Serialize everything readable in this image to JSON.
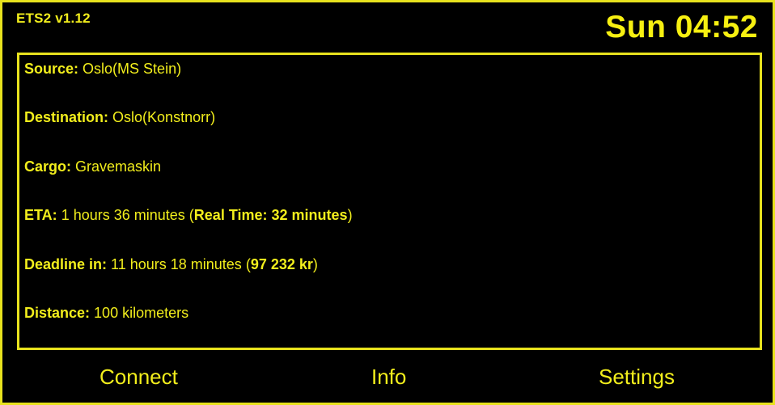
{
  "header": {
    "app_title": "ETS2 v1.12",
    "clock": "Sun 04:52"
  },
  "job": {
    "source": {
      "label": "Source:",
      "value": "Oslo(MS Stein)"
    },
    "destination": {
      "label": "Destination:",
      "value": "Oslo(Konstnorr)"
    },
    "cargo": {
      "label": "Cargo:",
      "value": "Gravemaskin"
    },
    "eta": {
      "label": "ETA:",
      "value": "1 hours 36 minutes",
      "paren_open": "(",
      "real_time_label": "Real Time:",
      "real_time_value": "32 minutes",
      "paren_close": ")"
    },
    "deadline": {
      "label": "Deadline in:",
      "value": "11 hours 18 minutes",
      "paren_open": "(",
      "income": "97 232 kr",
      "paren_close": ")"
    },
    "distance": {
      "label": "Distance:",
      "value": "100 kilometers"
    }
  },
  "nav": {
    "connect": "Connect",
    "info": "Info",
    "settings": "Settings"
  },
  "colors": {
    "accent": "#f2ee1c",
    "border": "#e8e21e",
    "background": "#000000"
  }
}
